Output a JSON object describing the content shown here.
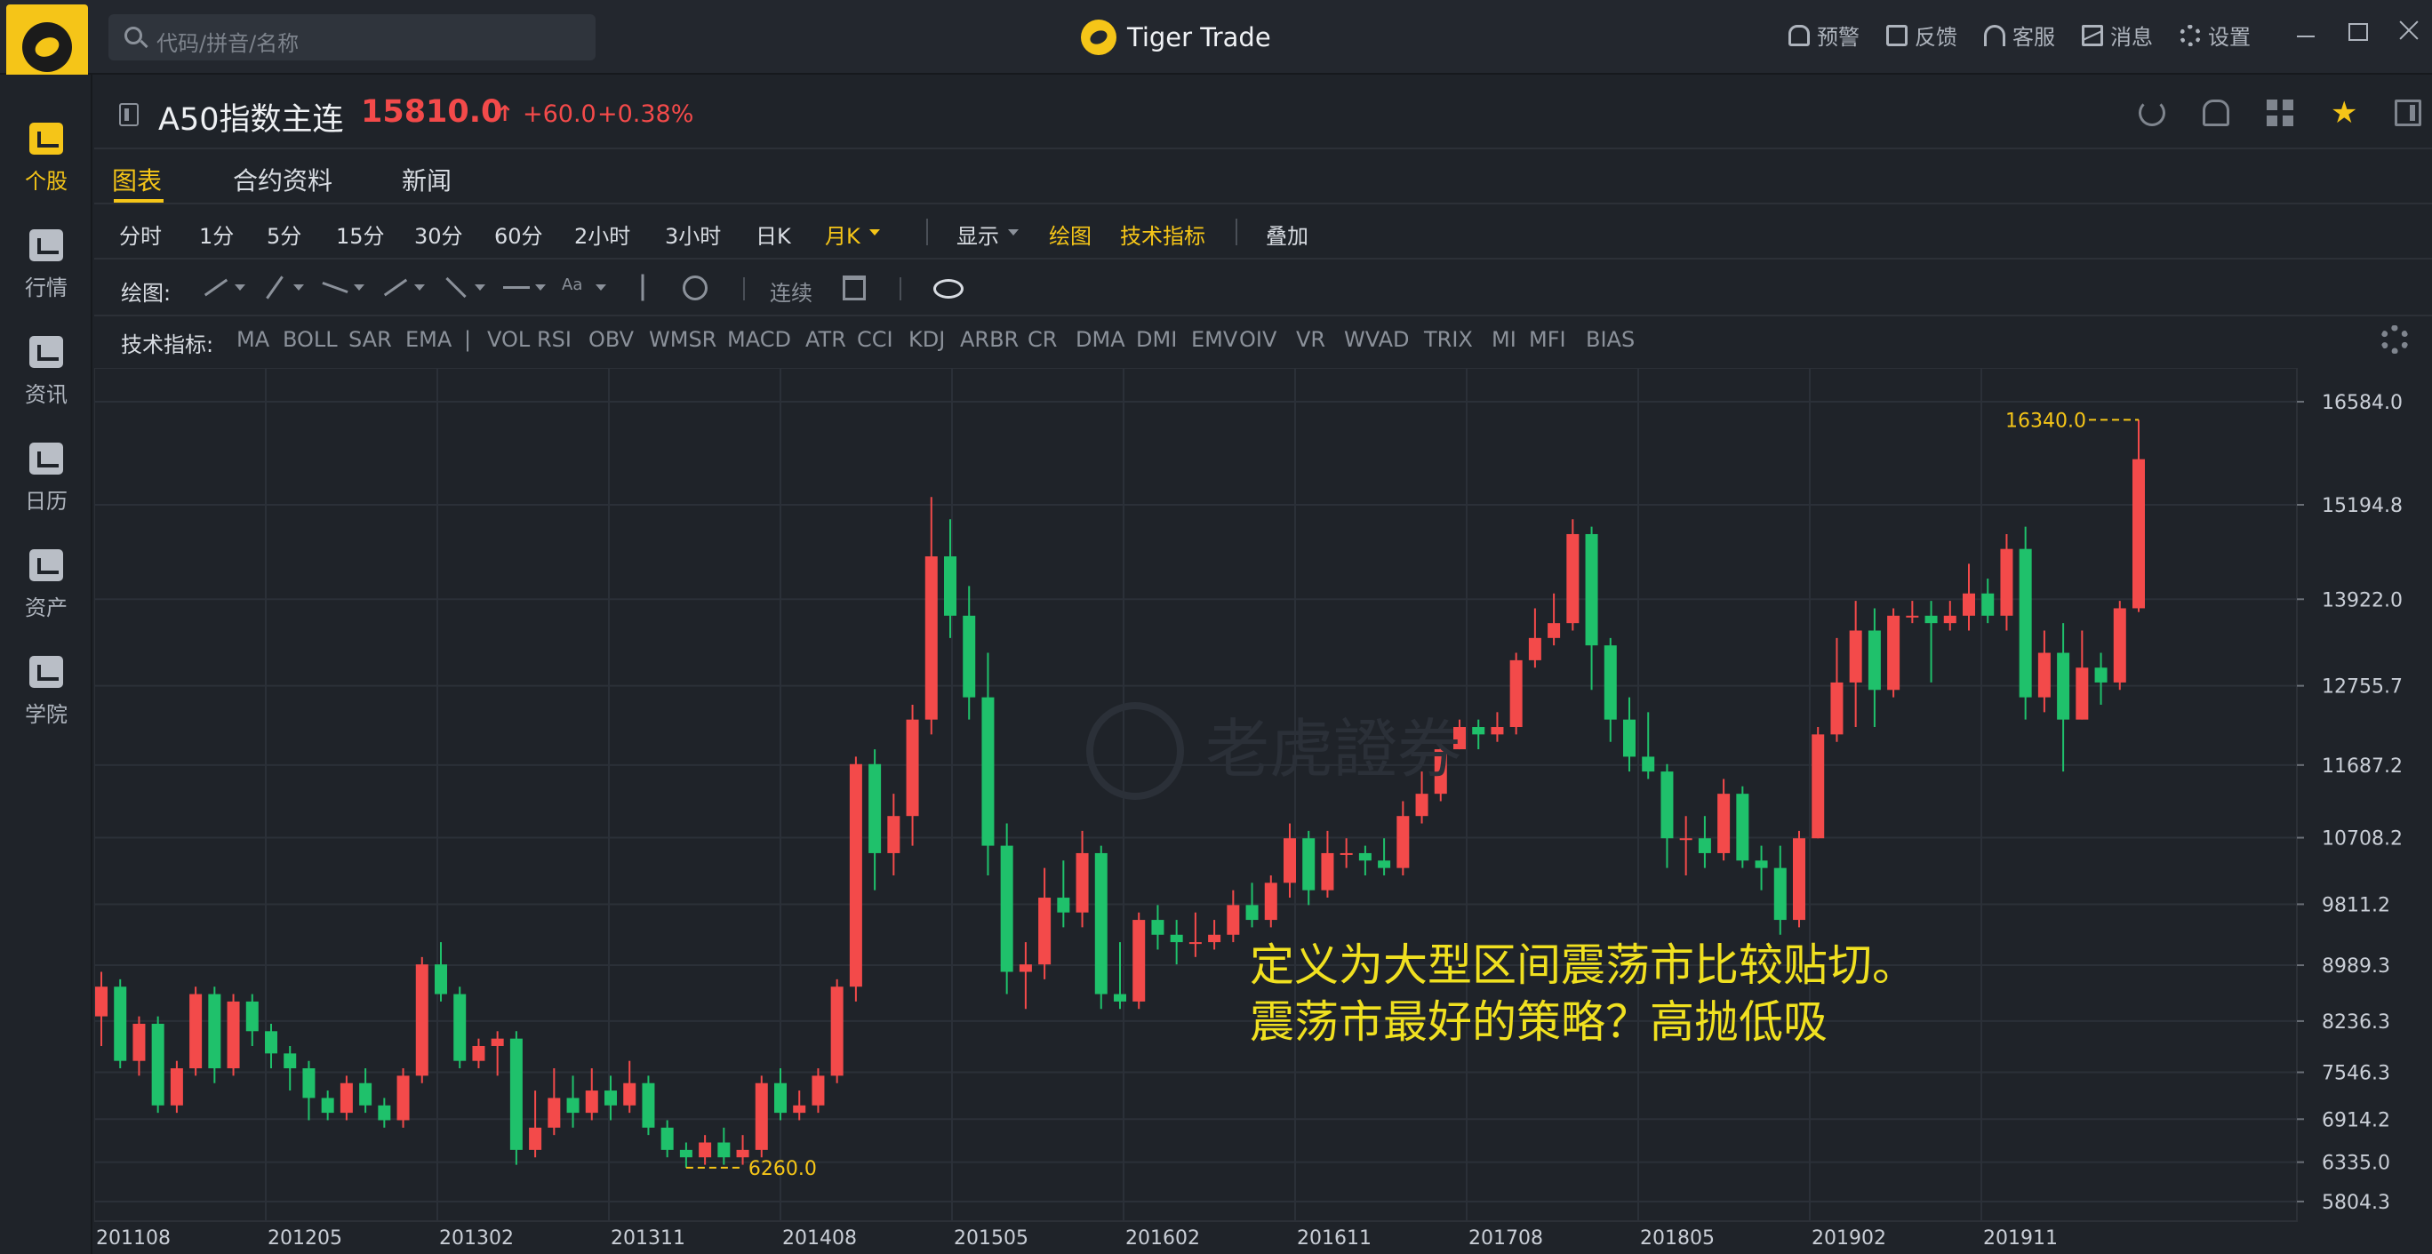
{
  "app": {
    "brand": "Tiger Trade",
    "search_placeholder": "代码/拼音/名称"
  },
  "top_actions": [
    "预警",
    "反馈",
    "客服",
    "消息",
    "设置"
  ],
  "sidebar": {
    "items": [
      {
        "label": "个股",
        "icon": "chart-icon",
        "active": true
      },
      {
        "label": "行情",
        "icon": "market-icon",
        "active": false
      },
      {
        "label": "资讯",
        "icon": "news-icon",
        "active": false
      },
      {
        "label": "日历",
        "icon": "calendar-icon",
        "active": false
      },
      {
        "label": "资产",
        "icon": "wallet-icon",
        "active": false
      },
      {
        "label": "学院",
        "icon": "video-icon",
        "active": false
      }
    ]
  },
  "quote": {
    "name": "A50指数主连",
    "price": "15810.0",
    "arrow": "↑",
    "change": "+60.0",
    "change_pct": "+0.38%"
  },
  "tabs": [
    "图表",
    "合约资料",
    "新闻"
  ],
  "periods": [
    "分时",
    "1分",
    "5分",
    "15分",
    "30分",
    "60分",
    "2小时",
    "3小时",
    "日K",
    "月K"
  ],
  "period_active": "月K",
  "toolbar": {
    "display": "显示",
    "draw": "绘图",
    "indicators": "技术指标",
    "overlay": "叠加"
  },
  "draw_row": {
    "label": "绘图:",
    "continuous": "连续"
  },
  "indicator_row": {
    "label": "技术指标:",
    "items": [
      "MA",
      "BOLL",
      "SAR",
      "EMA",
      "|",
      "VOL",
      "RSI",
      "OBV",
      "WMSR",
      "MACD",
      "ATR",
      "CCI",
      "KDJ",
      "ARBR",
      "CR",
      "DMA",
      "DMI",
      "EMV",
      "OIV",
      "VR",
      "WVAD",
      "TRIX",
      "MI",
      "MFI",
      "BIAS"
    ]
  },
  "annotation": {
    "line1": "定义为大型区间震荡市比较贴切。",
    "line2": "震荡市最好的策略？高抛低吸"
  },
  "watermark": "老虎證券",
  "colors": {
    "up": "#f34a4a",
    "down": "#1fc16b",
    "accent": "#f5c518",
    "annotation": "#f0e020"
  },
  "chart_data": {
    "type": "candlestick",
    "ylim": [
      5600,
      16800
    ],
    "y_ticks": [
      "16584.0",
      "15194.8",
      "13922.0",
      "12755.7",
      "11687.2",
      "10708.2",
      "9811.2",
      "8989.3",
      "8236.3",
      "7546.3",
      "6914.2",
      "6335.0",
      "5804.3"
    ],
    "x_labels": [
      "201108",
      "201205",
      "201302",
      "201311",
      "201408",
      "201505",
      "201602",
      "201611",
      "201708",
      "201805",
      "201902",
      "201911"
    ],
    "max_label": "16340.0",
    "min_label": "6260.0",
    "candles": [
      [
        8300,
        8700,
        8900,
        7900
      ],
      [
        8700,
        7700,
        8800,
        7600
      ],
      [
        7700,
        8200,
        8300,
        7500
      ],
      [
        8200,
        7100,
        8300,
        7000
      ],
      [
        7100,
        7600,
        7700,
        7000
      ],
      [
        7600,
        8600,
        8700,
        7500
      ],
      [
        8600,
        7600,
        8700,
        7400
      ],
      [
        7600,
        8500,
        8600,
        7500
      ],
      [
        8500,
        8100,
        8600,
        7900
      ],
      [
        8100,
        7800,
        8200,
        7600
      ],
      [
        7800,
        7600,
        7900,
        7300
      ],
      [
        7600,
        7200,
        7700,
        6900
      ],
      [
        7200,
        7000,
        7300,
        6900
      ],
      [
        7000,
        7400,
        7500,
        6900
      ],
      [
        7400,
        7100,
        7600,
        7000
      ],
      [
        7100,
        6900,
        7200,
        6800
      ],
      [
        6900,
        7500,
        7600,
        6800
      ],
      [
        7500,
        9000,
        9100,
        7400
      ],
      [
        9000,
        8600,
        9300,
        8500
      ],
      [
        8600,
        7700,
        8700,
        7600
      ],
      [
        7700,
        7900,
        8000,
        7600
      ],
      [
        7900,
        8000,
        8100,
        7500
      ],
      [
        8000,
        6500,
        8100,
        6300
      ],
      [
        6500,
        6800,
        7300,
        6400
      ],
      [
        6800,
        7200,
        7600,
        6700
      ],
      [
        7200,
        7000,
        7500,
        6800
      ],
      [
        7000,
        7300,
        7600,
        6900
      ],
      [
        7300,
        7100,
        7500,
        6900
      ],
      [
        7100,
        7400,
        7700,
        7000
      ],
      [
        7400,
        6800,
        7500,
        6700
      ],
      [
        6800,
        6500,
        6900,
        6400
      ],
      [
        6500,
        6400,
        6600,
        6260
      ],
      [
        6400,
        6600,
        6700,
        6300
      ],
      [
        6600,
        6400,
        6800,
        6300
      ],
      [
        6400,
        6500,
        6700,
        6300
      ],
      [
        6500,
        7400,
        7500,
        6400
      ],
      [
        7400,
        7000,
        7600,
        6900
      ],
      [
        7000,
        7100,
        7300,
        6900
      ],
      [
        7100,
        7500,
        7600,
        7000
      ],
      [
        7500,
        8700,
        8800,
        7400
      ],
      [
        8700,
        11700,
        11800,
        8500
      ],
      [
        11700,
        10500,
        11900,
        10000
      ],
      [
        10500,
        11000,
        11300,
        10200
      ],
      [
        11000,
        12300,
        12500,
        10600
      ],
      [
        12300,
        14500,
        15300,
        12100
      ],
      [
        14500,
        13700,
        15000,
        13400
      ],
      [
        13700,
        12600,
        14100,
        12300
      ],
      [
        12600,
        10600,
        13200,
        10200
      ],
      [
        10600,
        8900,
        10900,
        8600
      ],
      [
        8900,
        9000,
        9300,
        8400
      ],
      [
        9000,
        9900,
        10300,
        8800
      ],
      [
        9900,
        9700,
        10400,
        9500
      ],
      [
        9700,
        10500,
        10800,
        9500
      ],
      [
        10500,
        8600,
        10600,
        8400
      ],
      [
        8600,
        8500,
        9300,
        8400
      ],
      [
        8500,
        9600,
        9700,
        8400
      ],
      [
        9600,
        9400,
        9800,
        9200
      ],
      [
        9400,
        9300,
        9600,
        9000
      ],
      [
        9300,
        9300,
        9700,
        9100
      ],
      [
        9300,
        9400,
        9600,
        9200
      ],
      [
        9400,
        9800,
        10000,
        9300
      ],
      [
        9800,
        9600,
        10100,
        9500
      ],
      [
        9600,
        10100,
        10200,
        9500
      ],
      [
        10100,
        10700,
        10900,
        9900
      ],
      [
        10700,
        10000,
        10800,
        9800
      ],
      [
        10000,
        10500,
        10800,
        9900
      ],
      [
        10500,
        10500,
        10700,
        10300
      ],
      [
        10500,
        10400,
        10600,
        10200
      ],
      [
        10400,
        10300,
        10700,
        10200
      ],
      [
        10300,
        11000,
        11200,
        10200
      ],
      [
        11000,
        11300,
        11600,
        10900
      ],
      [
        11300,
        11900,
        12000,
        11200
      ],
      [
        11900,
        12200,
        12300,
        11900
      ],
      [
        12200,
        12100,
        12300,
        11900
      ],
      [
        12100,
        12200,
        12400,
        12000
      ],
      [
        12200,
        13100,
        13200,
        12100
      ],
      [
        13100,
        13400,
        13800,
        13000
      ],
      [
        13400,
        13600,
        14000,
        13300
      ],
      [
        13600,
        14800,
        15000,
        13500
      ],
      [
        14800,
        13300,
        14900,
        12700
      ],
      [
        13300,
        12300,
        13400,
        12000
      ],
      [
        12300,
        11800,
        12600,
        11600
      ],
      [
        11800,
        11600,
        12400,
        11500
      ],
      [
        11600,
        10700,
        11700,
        10300
      ],
      [
        10700,
        10700,
        11000,
        10200
      ],
      [
        10700,
        10500,
        11000,
        10300
      ],
      [
        10500,
        11300,
        11500,
        10400
      ],
      [
        11300,
        10400,
        11400,
        10300
      ],
      [
        10400,
        10300,
        10600,
        10000
      ],
      [
        10300,
        9600,
        10600,
        9400
      ],
      [
        9600,
        10700,
        10800,
        9500
      ],
      [
        10700,
        12100,
        12200,
        10700
      ],
      [
        12100,
        12800,
        13400,
        12000
      ],
      [
        12800,
        13500,
        13900,
        12200
      ],
      [
        13500,
        12700,
        13800,
        12200
      ],
      [
        12700,
        13700,
        13800,
        12600
      ],
      [
        13700,
        13700,
        13900,
        13600
      ],
      [
        13700,
        13600,
        13900,
        12800
      ],
      [
        13600,
        13700,
        13900,
        13500
      ],
      [
        13700,
        14000,
        14400,
        13500
      ],
      [
        14000,
        13700,
        14200,
        13600
      ],
      [
        13700,
        14600,
        14800,
        13500
      ],
      [
        14600,
        12600,
        14900,
        12300
      ],
      [
        12600,
        13200,
        13500,
        12400
      ],
      [
        13200,
        12300,
        13600,
        11600
      ],
      [
        12300,
        13000,
        13500,
        12300
      ],
      [
        13000,
        12800,
        13200,
        12500
      ],
      [
        12800,
        13800,
        13900,
        12700
      ],
      [
        13800,
        15810,
        16340,
        13750
      ]
    ]
  }
}
